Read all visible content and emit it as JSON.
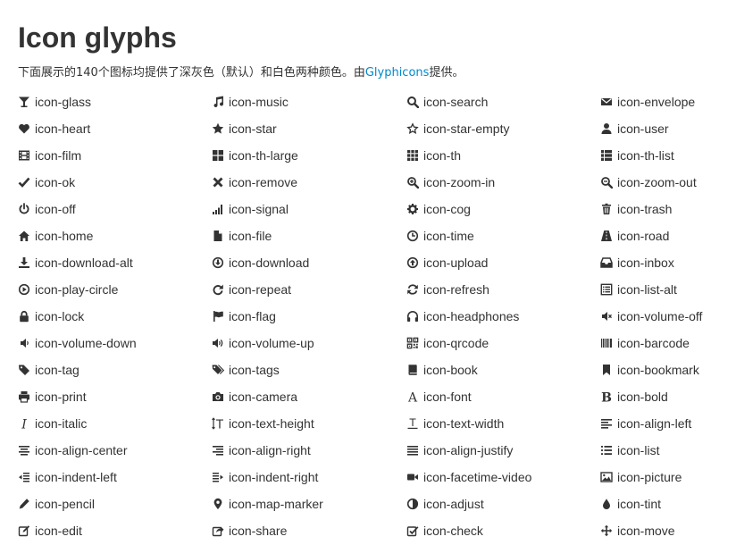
{
  "title": "Icon glyphs",
  "intro": {
    "before": "下面展示的140个图标均提供了深灰色（默认）和白色两种颜色。由",
    "link": "Glyphicons",
    "after": "提供。"
  },
  "accent_color": "#0088cc",
  "icons": [
    {
      "label": "icon-glass",
      "icon": "glass-icon"
    },
    {
      "label": "icon-music",
      "icon": "music-icon"
    },
    {
      "label": "icon-search",
      "icon": "search-icon"
    },
    {
      "label": "icon-envelope",
      "icon": "envelope-icon"
    },
    {
      "label": "icon-heart",
      "icon": "heart-icon"
    },
    {
      "label": "icon-star",
      "icon": "star-icon"
    },
    {
      "label": "icon-star-empty",
      "icon": "star-empty-icon"
    },
    {
      "label": "icon-user",
      "icon": "user-icon"
    },
    {
      "label": "icon-film",
      "icon": "film-icon"
    },
    {
      "label": "icon-th-large",
      "icon": "th-large-icon"
    },
    {
      "label": "icon-th",
      "icon": "th-icon"
    },
    {
      "label": "icon-th-list",
      "icon": "th-list-icon"
    },
    {
      "label": "icon-ok",
      "icon": "ok-icon"
    },
    {
      "label": "icon-remove",
      "icon": "remove-icon"
    },
    {
      "label": "icon-zoom-in",
      "icon": "zoom-in-icon"
    },
    {
      "label": "icon-zoom-out",
      "icon": "zoom-out-icon"
    },
    {
      "label": "icon-off",
      "icon": "off-icon"
    },
    {
      "label": "icon-signal",
      "icon": "signal-icon"
    },
    {
      "label": "icon-cog",
      "icon": "cog-icon"
    },
    {
      "label": "icon-trash",
      "icon": "trash-icon"
    },
    {
      "label": "icon-home",
      "icon": "home-icon"
    },
    {
      "label": "icon-file",
      "icon": "file-icon"
    },
    {
      "label": "icon-time",
      "icon": "time-icon"
    },
    {
      "label": "icon-road",
      "icon": "road-icon"
    },
    {
      "label": "icon-download-alt",
      "icon": "download-alt-icon"
    },
    {
      "label": "icon-download",
      "icon": "download-icon"
    },
    {
      "label": "icon-upload",
      "icon": "upload-icon"
    },
    {
      "label": "icon-inbox",
      "icon": "inbox-icon"
    },
    {
      "label": "icon-play-circle",
      "icon": "play-circle-icon"
    },
    {
      "label": "icon-repeat",
      "icon": "repeat-icon"
    },
    {
      "label": "icon-refresh",
      "icon": "refresh-icon"
    },
    {
      "label": "icon-list-alt",
      "icon": "list-alt-icon"
    },
    {
      "label": "icon-lock",
      "icon": "lock-icon"
    },
    {
      "label": "icon-flag",
      "icon": "flag-icon"
    },
    {
      "label": "icon-headphones",
      "icon": "headphones-icon"
    },
    {
      "label": "icon-volume-off",
      "icon": "volume-off-icon"
    },
    {
      "label": "icon-volume-down",
      "icon": "volume-down-icon"
    },
    {
      "label": "icon-volume-up",
      "icon": "volume-up-icon"
    },
    {
      "label": "icon-qrcode",
      "icon": "qrcode-icon"
    },
    {
      "label": "icon-barcode",
      "icon": "barcode-icon"
    },
    {
      "label": "icon-tag",
      "icon": "tag-icon"
    },
    {
      "label": "icon-tags",
      "icon": "tags-icon"
    },
    {
      "label": "icon-book",
      "icon": "book-icon"
    },
    {
      "label": "icon-bookmark",
      "icon": "bookmark-icon"
    },
    {
      "label": "icon-print",
      "icon": "print-icon"
    },
    {
      "label": "icon-camera",
      "icon": "camera-icon"
    },
    {
      "label": "icon-font",
      "icon": "font-icon"
    },
    {
      "label": "icon-bold",
      "icon": "bold-icon"
    },
    {
      "label": "icon-italic",
      "icon": "italic-icon"
    },
    {
      "label": "icon-text-height",
      "icon": "text-height-icon"
    },
    {
      "label": "icon-text-width",
      "icon": "text-width-icon"
    },
    {
      "label": "icon-align-left",
      "icon": "align-left-icon"
    },
    {
      "label": "icon-align-center",
      "icon": "align-center-icon"
    },
    {
      "label": "icon-align-right",
      "icon": "align-right-icon"
    },
    {
      "label": "icon-align-justify",
      "icon": "align-justify-icon"
    },
    {
      "label": "icon-list",
      "icon": "list-icon"
    },
    {
      "label": "icon-indent-left",
      "icon": "indent-left-icon"
    },
    {
      "label": "icon-indent-right",
      "icon": "indent-right-icon"
    },
    {
      "label": "icon-facetime-video",
      "icon": "facetime-video-icon"
    },
    {
      "label": "icon-picture",
      "icon": "picture-icon"
    },
    {
      "label": "icon-pencil",
      "icon": "pencil-icon"
    },
    {
      "label": "icon-map-marker",
      "icon": "map-marker-icon"
    },
    {
      "label": "icon-adjust",
      "icon": "adjust-icon"
    },
    {
      "label": "icon-tint",
      "icon": "tint-icon"
    },
    {
      "label": "icon-edit",
      "icon": "edit-icon"
    },
    {
      "label": "icon-share",
      "icon": "share-icon"
    },
    {
      "label": "icon-check",
      "icon": "check-icon"
    },
    {
      "label": "icon-move",
      "icon": "move-icon"
    }
  ]
}
